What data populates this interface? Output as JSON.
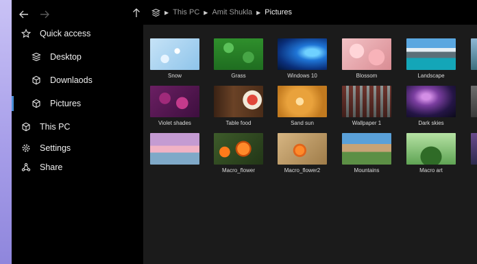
{
  "nav": {
    "back_icon": "arrow-left-icon",
    "forward_icon": "arrow-right-icon"
  },
  "sidebar": {
    "items": [
      {
        "label": "Quick access",
        "icon": "star-icon"
      },
      {
        "label": "Desktop",
        "icon": "stack-icon"
      },
      {
        "label": "Downlaods",
        "icon": "cube-icon"
      },
      {
        "label": "Pictures",
        "icon": "cube-icon",
        "selected": true
      },
      {
        "label": "This PC",
        "icon": "cube-icon"
      },
      {
        "label": "Settings",
        "icon": "gear-icon"
      },
      {
        "label": "Share",
        "icon": "share-icon"
      }
    ]
  },
  "breadcrumb": {
    "up_icon": "arrow-up-icon",
    "root_icon": "stack-icon",
    "items": [
      "This PC",
      "Amit Shukla",
      "Pictures"
    ]
  },
  "gallery": {
    "rows": [
      [
        "Snow",
        "Grass",
        "Windows 10",
        "Blossom",
        "Landscape"
      ],
      [
        "Violet shades",
        "Table food",
        "Sand sun",
        "Wallpaper 1",
        "Dark skies"
      ],
      [
        "",
        "Macro_flower",
        "Macro_flower2",
        "Mountains",
        "Macro art"
      ]
    ]
  },
  "colors": {
    "accent_strip": "#a79ee9",
    "selection": "#4a90d9",
    "sidebar_bg": "#000000",
    "content_bg": "#1b1b1b"
  }
}
